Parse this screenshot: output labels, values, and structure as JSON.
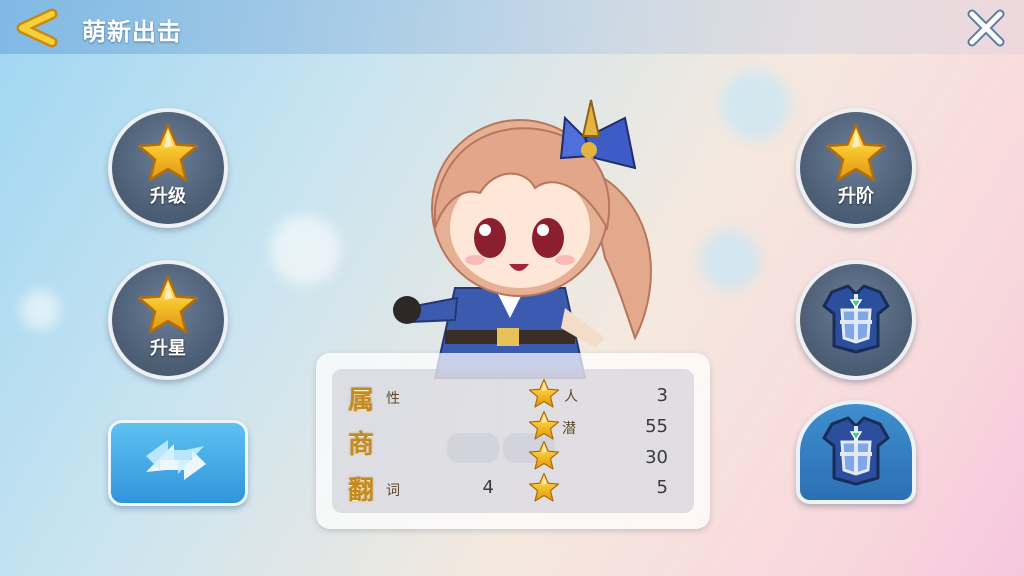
{
  "header": {
    "title": "萌新出击"
  },
  "left_buttons": [
    {
      "label": "升级",
      "icon": "star-icon"
    },
    {
      "label": "升星",
      "icon": "star-icon"
    },
    {
      "label": "",
      "icon": "swap-arrows-icon"
    }
  ],
  "right_buttons": [
    {
      "label": "升阶",
      "icon": "star-icon"
    },
    {
      "label": "",
      "icon": "armor-icon"
    },
    {
      "label": "",
      "icon": "armor-icon"
    }
  ],
  "stats_panel": {
    "left_chars": [
      {
        "big": "属",
        "small": "性"
      },
      {
        "big": "商",
        "small": ""
      },
      {
        "big": "翻",
        "small": "词"
      }
    ],
    "left_value": "4",
    "rows": [
      {
        "label": "人",
        "value": "3"
      },
      {
        "label": "潜",
        "value": "55"
      },
      {
        "label": "",
        "value": "30"
      },
      {
        "label": "",
        "value": "5"
      }
    ]
  },
  "colors": {
    "gold": "#f5c12a",
    "button_gray": "#54667c",
    "button_blue": "#2f95db",
    "armor_blue": "#2b4f9c"
  }
}
